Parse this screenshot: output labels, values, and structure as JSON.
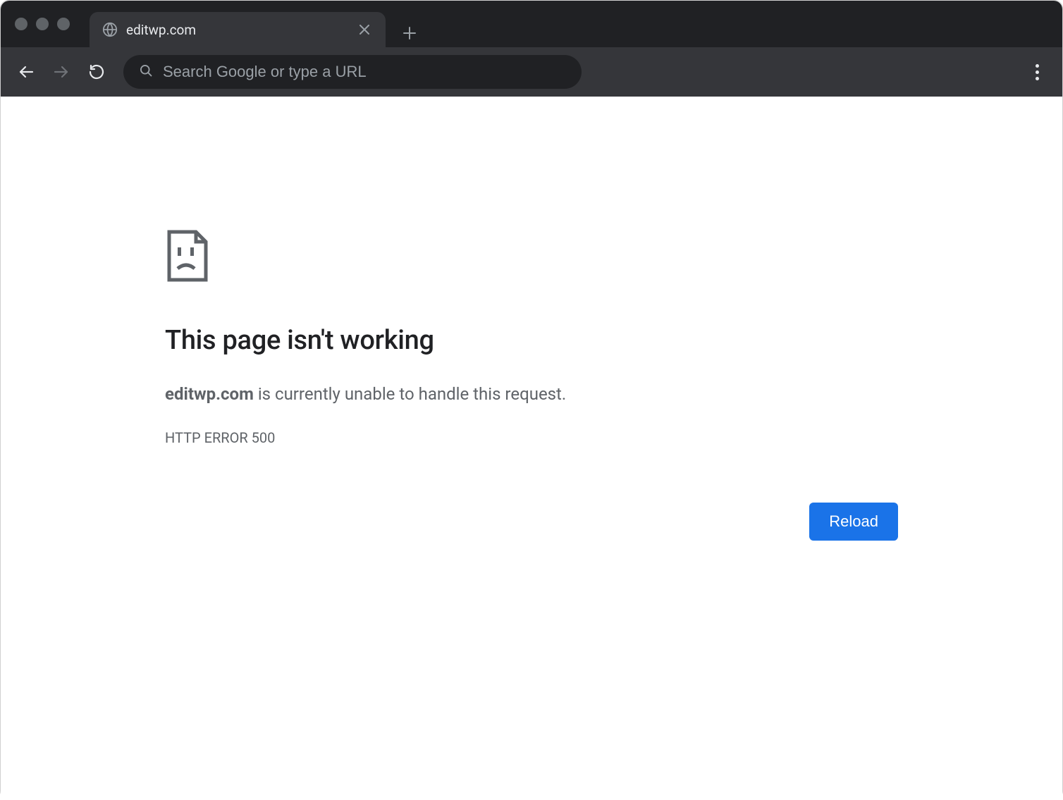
{
  "browser": {
    "tab": {
      "title": "editwp.com"
    },
    "omnibox": {
      "placeholder": "Search Google or type a URL",
      "value": ""
    }
  },
  "error": {
    "title": "This page isn't working",
    "domain": "editwp.com",
    "desc_suffix": " is currently unable to handle this request.",
    "code": "HTTP ERROR 500",
    "reload_label": "Reload"
  }
}
